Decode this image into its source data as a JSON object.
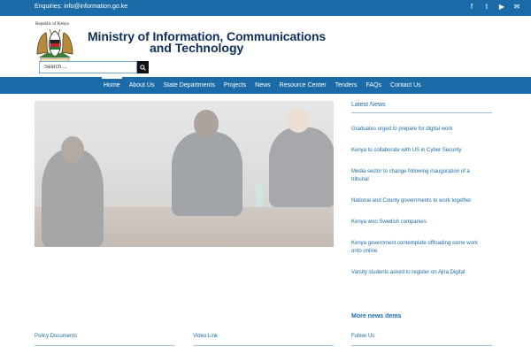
{
  "topbar": {
    "enquiries": "Enquiries: info@information.go.ke",
    "social": [
      "f",
      "t",
      "▶",
      "✉"
    ],
    "social_icons": [
      "facebook-icon",
      "twitter-icon",
      "youtube-icon",
      "email-icon"
    ]
  },
  "header": {
    "coat_caption": "Republic of Kenya",
    "title_line1": "Ministry of Information, Communications",
    "title_line2": "and Technology",
    "search_placeholder": "Search ..."
  },
  "nav": {
    "items": [
      "Home",
      "About Us",
      "State Departments",
      "Projects",
      "News",
      "Resource Center",
      "Tenders",
      "FAQs",
      "Contact Us"
    ],
    "active": "Home"
  },
  "sidebar": {
    "title": "Latest News",
    "news": [
      "Graduates urged to prepare for digital work",
      "Kenya to collaborate with US in Cyber Security",
      "Media sector to change following inauguration of a tribunal",
      "National and County governments to work together",
      "Kenya woo Swedish companies",
      "Kenya government contemplate offloading some work onto online",
      "Varsity students asked to register on Ajira Digital"
    ],
    "more": "More news items"
  },
  "footer": {
    "col1": "Policy Documents",
    "col2": "Video Link",
    "col3": "Follow Us"
  },
  "colors": {
    "brand_blue": "#1b6ba8",
    "title_navy": "#0d2f5c"
  }
}
